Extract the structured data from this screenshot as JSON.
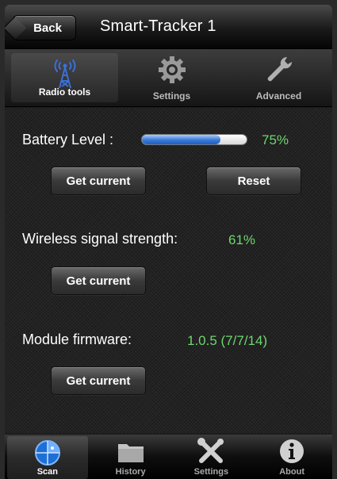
{
  "navbar": {
    "back_label": "Back",
    "title": "Smart-Tracker 1"
  },
  "top_tabs": [
    {
      "label": "Radio tools",
      "icon": "radio-tower-icon",
      "active": true
    },
    {
      "label": "Settings",
      "icon": "gear-icon",
      "active": false
    },
    {
      "label": "Advanced",
      "icon": "wrench-icon",
      "active": false
    }
  ],
  "battery": {
    "label": "Battery Level :",
    "value_text": "75%",
    "level": 0.75,
    "get_current_label": "Get current",
    "reset_label": "Reset"
  },
  "wireless": {
    "label": "Wireless signal strength:",
    "value_text": "61%",
    "get_current_label": "Get current"
  },
  "firmware": {
    "label": "Module firmware:",
    "value_text": "1.0.5 (7/7/14)",
    "get_current_label": "Get current"
  },
  "bottom_tabs": [
    {
      "label": "Scan",
      "icon": "scan-radar-icon",
      "active": true
    },
    {
      "label": "History",
      "icon": "folder-icon",
      "active": false
    },
    {
      "label": "Settings",
      "icon": "tools-icon",
      "active": false
    },
    {
      "label": "About",
      "icon": "info-icon",
      "active": false
    }
  ],
  "colors": {
    "value_green": "#6fd66f",
    "accent_blue": "#3a7ad8"
  }
}
